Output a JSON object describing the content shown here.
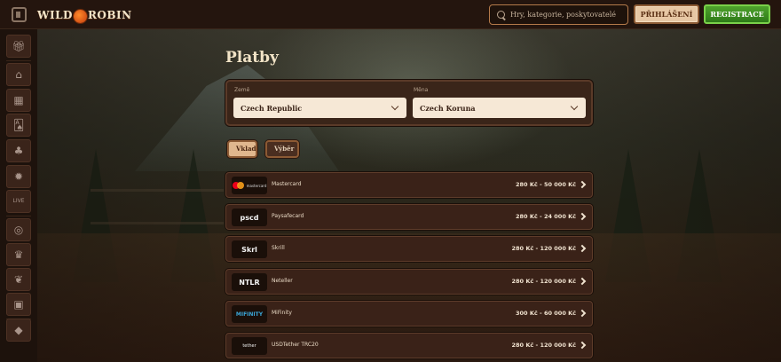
{
  "header": {
    "logo": {
      "part1": "WILD",
      "part2": "ROBIN"
    },
    "search": {
      "placeholder": "Hry, kategorie, poskytovatelé"
    },
    "login_label": "PŘIHLÁŠENÍ",
    "register_label": "REGISTRACE"
  },
  "sidebar": {
    "items": [
      {
        "name": "gift-icon",
        "glyph": "🎁︎"
      },
      {
        "name": "home-icon",
        "glyph": "⌂"
      },
      {
        "name": "slots-icon",
        "glyph": "▦"
      },
      {
        "name": "cards-icon",
        "glyph": "🂡"
      },
      {
        "name": "clover-icon",
        "glyph": "♣"
      },
      {
        "name": "roulette-icon",
        "glyph": "✹"
      },
      {
        "name": "live-icon",
        "glyph": "LIVE"
      },
      {
        "name": "target-icon",
        "glyph": "◎"
      },
      {
        "name": "trophy-icon",
        "glyph": "♛"
      },
      {
        "name": "leaf-icon",
        "glyph": "❦"
      },
      {
        "name": "bag-icon",
        "glyph": "▣"
      },
      {
        "name": "diamond-icon",
        "glyph": "◆"
      }
    ]
  },
  "main": {
    "title": "Platby",
    "filters": {
      "country_label": "Země",
      "country_value": "Czech Republic",
      "currency_label": "Měna",
      "currency_value": "Czech Koruna"
    },
    "tabs": [
      {
        "label": "Vklad",
        "active": true
      },
      {
        "label": "Výběr",
        "active": false
      }
    ],
    "methods": [
      {
        "logo": "mastercard",
        "name": "Mastercard",
        "range": "280 Kč - 50 000 Kč"
      },
      {
        "logo": "pscd",
        "name": "Paysafecard",
        "range": "280 Kč - 24 000 Kč"
      },
      {
        "logo": "Skrl",
        "name": "Skrill",
        "range": "280 Kč - 120 000 Kč"
      },
      {
        "logo": "NTLR",
        "name": "Neteller",
        "range": "280 Kč - 120 000 Kč"
      },
      {
        "logo": "MIFINITY",
        "name": "MiFinity",
        "range": "300 Kč - 60 000 Kč"
      },
      {
        "logo": "tether",
        "name": "USDTether TRC20",
        "range": "280 Kč - 120 000 Kč"
      }
    ]
  },
  "colors": {
    "accent": "#8c5a34",
    "register_green": "#3a8a20",
    "panel": "#3a2218"
  }
}
